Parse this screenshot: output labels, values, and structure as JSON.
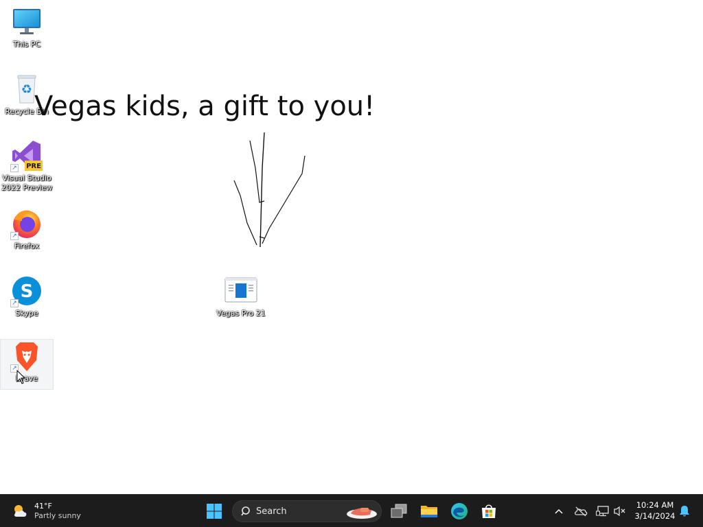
{
  "desktop": {
    "icons": [
      {
        "name": "this-pc",
        "label": "This PC",
        "shortcut": false
      },
      {
        "name": "recycle-bin",
        "label": "Recycle Bin",
        "shortcut": false
      },
      {
        "name": "visual-studio",
        "label": "Visual Studio\n2022 Preview",
        "shortcut": true,
        "badge": "PRE"
      },
      {
        "name": "firefox",
        "label": "Firefox",
        "shortcut": true
      },
      {
        "name": "skype",
        "label": "Skype",
        "shortcut": true
      },
      {
        "name": "brave",
        "label": "Brave",
        "shortcut": true,
        "selected": true
      },
      {
        "name": "vegas-pro",
        "label": "Vegas Pro 21",
        "shortcut": false
      }
    ],
    "wallpaper_text": "Vegas kids, a gift to you!"
  },
  "taskbar": {
    "weather": {
      "temp": "41°F",
      "condition": "Partly sunny",
      "icon": "partly-sunny-icon"
    },
    "search_label": "Search",
    "pinned": [
      {
        "name": "start",
        "icon": "windows-logo-icon"
      },
      {
        "name": "task-view",
        "icon": "task-view-icon"
      },
      {
        "name": "file-explorer",
        "icon": "folder-icon"
      },
      {
        "name": "edge",
        "icon": "edge-icon"
      },
      {
        "name": "store",
        "icon": "store-icon"
      }
    ],
    "tray": {
      "icons": [
        "chevron-up-icon",
        "onedrive-offline-icon",
        "network-icon",
        "volume-muted-icon",
        "notification-bell-icon"
      ]
    },
    "clock": {
      "time": "10:24 AM",
      "date": "3/14/2024"
    }
  },
  "colors": {
    "taskbar_bg": "#1c1c1c",
    "accent": "#0078d4",
    "desktop_bg": "#ffffff"
  }
}
